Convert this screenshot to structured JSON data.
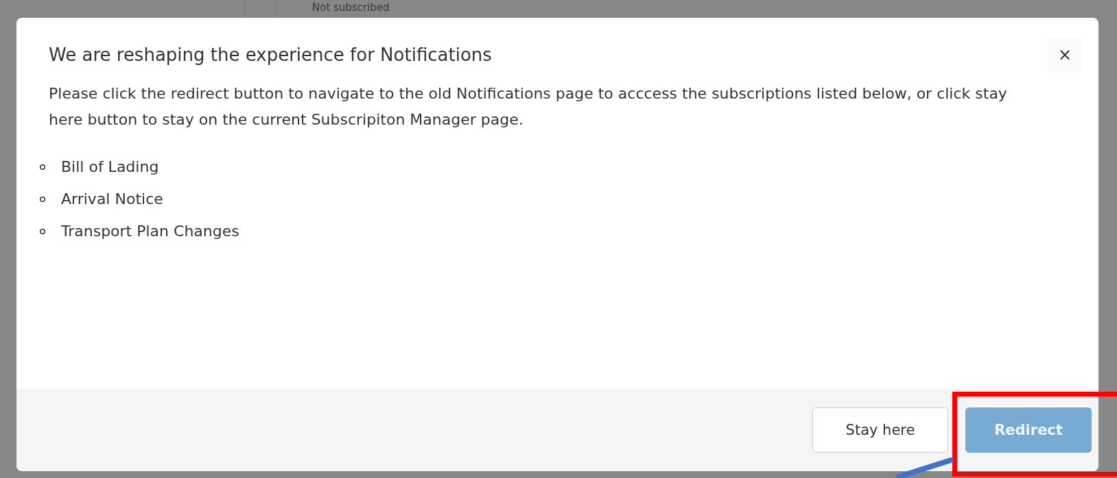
{
  "background": {
    "status_text": "Not subscribed"
  },
  "dialog": {
    "title": "We are reshaping the experience for Notifications",
    "close": "×",
    "message": "Please click the redirect button to navigate to the old Notifications page to acccess the subscriptions listed below, or click stay here button to stay on the current Subscripiton Manager page.",
    "items": [
      "Bill of Lading",
      "Arrival Notice",
      "Transport Plan Changes"
    ],
    "buttons": [
      {
        "label": "Stay here",
        "kind": "secondary",
        "disabled": false
      },
      {
        "label": "Redirect",
        "kind": "primary",
        "disabled": true
      }
    ]
  }
}
